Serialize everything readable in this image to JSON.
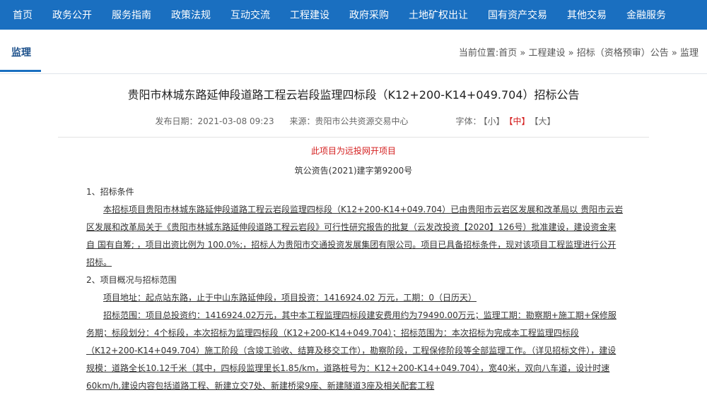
{
  "nav": [
    "首页",
    "政务公开",
    "服务指南",
    "政策法规",
    "互动交流",
    "工程建设",
    "政府采购",
    "土地矿权出让",
    "国有资产交易",
    "其他交易",
    "金融服务"
  ],
  "section_label": "监理",
  "breadcrumb": {
    "prefix": "当前位置:",
    "items": [
      "首页",
      "工程建设",
      "招标（资格预审）公告",
      "监理"
    ],
    "sep": " » "
  },
  "title": "贵阳市林城东路延伸段道路工程云岩段监理四标段（K12+200-K14+049.704）招标公告",
  "meta": {
    "pub": "发布日期：2021-03-08 09:23",
    "src": "来源：贵阳市公共资源交易中心",
    "font_label": "字体：",
    "font_small": "【小】",
    "font_mid": "【中】",
    "font_large": "【大】"
  },
  "notice_red": "此项目为远投网开项目",
  "doc_no": "筑公资告(2021)建字第9200号",
  "sec1_title": "1、招标条件",
  "p1": "本招标项目贵阳市林城东路延伸段道路工程云岩段监理四标段（K12+200-K14+049.704）已由贵阳市云岩区发展和改革局以 贵阳市云岩区发展和改革局关于《贵阳市林城东路延伸段道路工程云岩段》可行性研究报告的批复（云发改投资【2020】126号）批准建设，建设资金来自 国有自筹; ，项目出资比例为 100.0%;，招标人为贵阳市交通投资发展集团有限公司。项目已具备招标条件，现对该项目工程监理进行公开招标。",
  "sec2_title": "2、项目概况与招标范围",
  "p2": "项目地址：起点站东路，止于中山东路延伸段，项目投资：1416924.02 万元，工期：0（日历天）",
  "p3": "招标范围：项目总投资约：1416924.02万元，其中本工程监理四标段建安费用约为79490.00万元；监理工期：勘察期+施工期+保修服务期；标段划分：4个标段，本次招标为监理四标段（K12+200-K14+049.704）；招标范围为：本次招标为完成本工程监理四标段（K12+200-K14+049.704）施工阶段（含竣工验收、结算及移交工作），勘察阶段，工程保修阶段等全部监理工作。（详见招标文件），建设规模：道路全长10.12千米（其中，四标段监理里长1.85/km，道路桩号为：K12+200-K14+049.704），宽40米，双向八车道，设计时速60km/h,建设内容包括道路工程、新建立交7处、新建桥梁9座、新建隧道3座及相关配套工程"
}
